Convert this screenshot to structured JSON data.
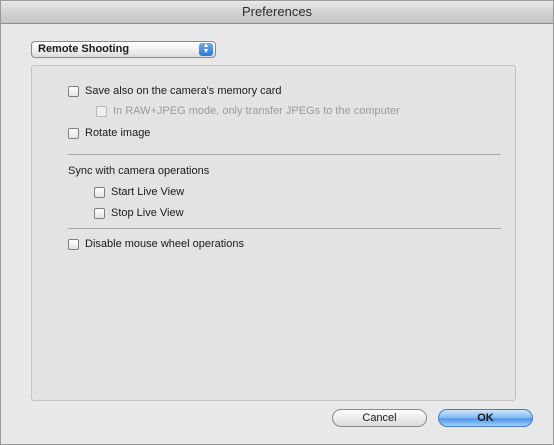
{
  "window": {
    "title": "Preferences"
  },
  "category": {
    "selected": "Remote Shooting"
  },
  "options": {
    "save_memory_card": "Save also on the camera's memory card",
    "raw_jpeg_transfer": "In RAW+JPEG mode, only transfer JPEGs to the computer",
    "rotate_image": "Rotate image",
    "sync_heading": "Sync with camera operations",
    "start_live_view": "Start Live View",
    "stop_live_view": "Stop Live View",
    "disable_mouse_wheel": "Disable mouse wheel operations"
  },
  "buttons": {
    "cancel": "Cancel",
    "ok": "OK"
  }
}
